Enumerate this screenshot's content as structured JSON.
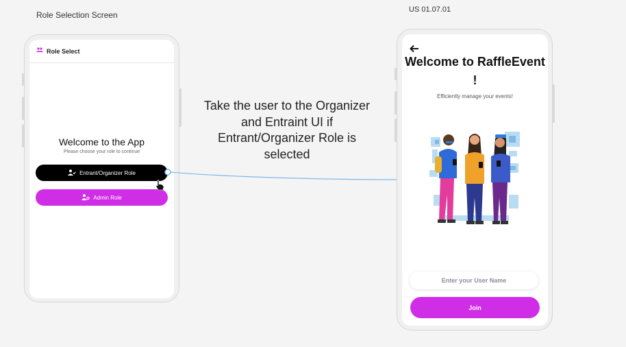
{
  "frames": {
    "left_label": "Role Selection Screen",
    "right_label": "US 01.07.01"
  },
  "role_screen": {
    "appbar_title": "Role Select",
    "appbar_icon": "users-icon",
    "welcome_title": "Welcome to the App",
    "welcome_subtitle": "Please choose your role to continue",
    "entrant_button": "Entrant/Organizer Role",
    "admin_button": "Admin Role"
  },
  "annotation": {
    "text": "Take the user to the Organizer and Entraint UI if Entrant/Organizer Role is selected"
  },
  "raffle_screen": {
    "title": "Welcome to RaffleEvent !",
    "subtitle": "Efficiently manage your events!",
    "username_placeholder": "Enter your User Name",
    "join_button": "Join"
  },
  "colors": {
    "accent": "#d02ee6",
    "black_button": "#000000",
    "connector": "#7ab7ea"
  }
}
